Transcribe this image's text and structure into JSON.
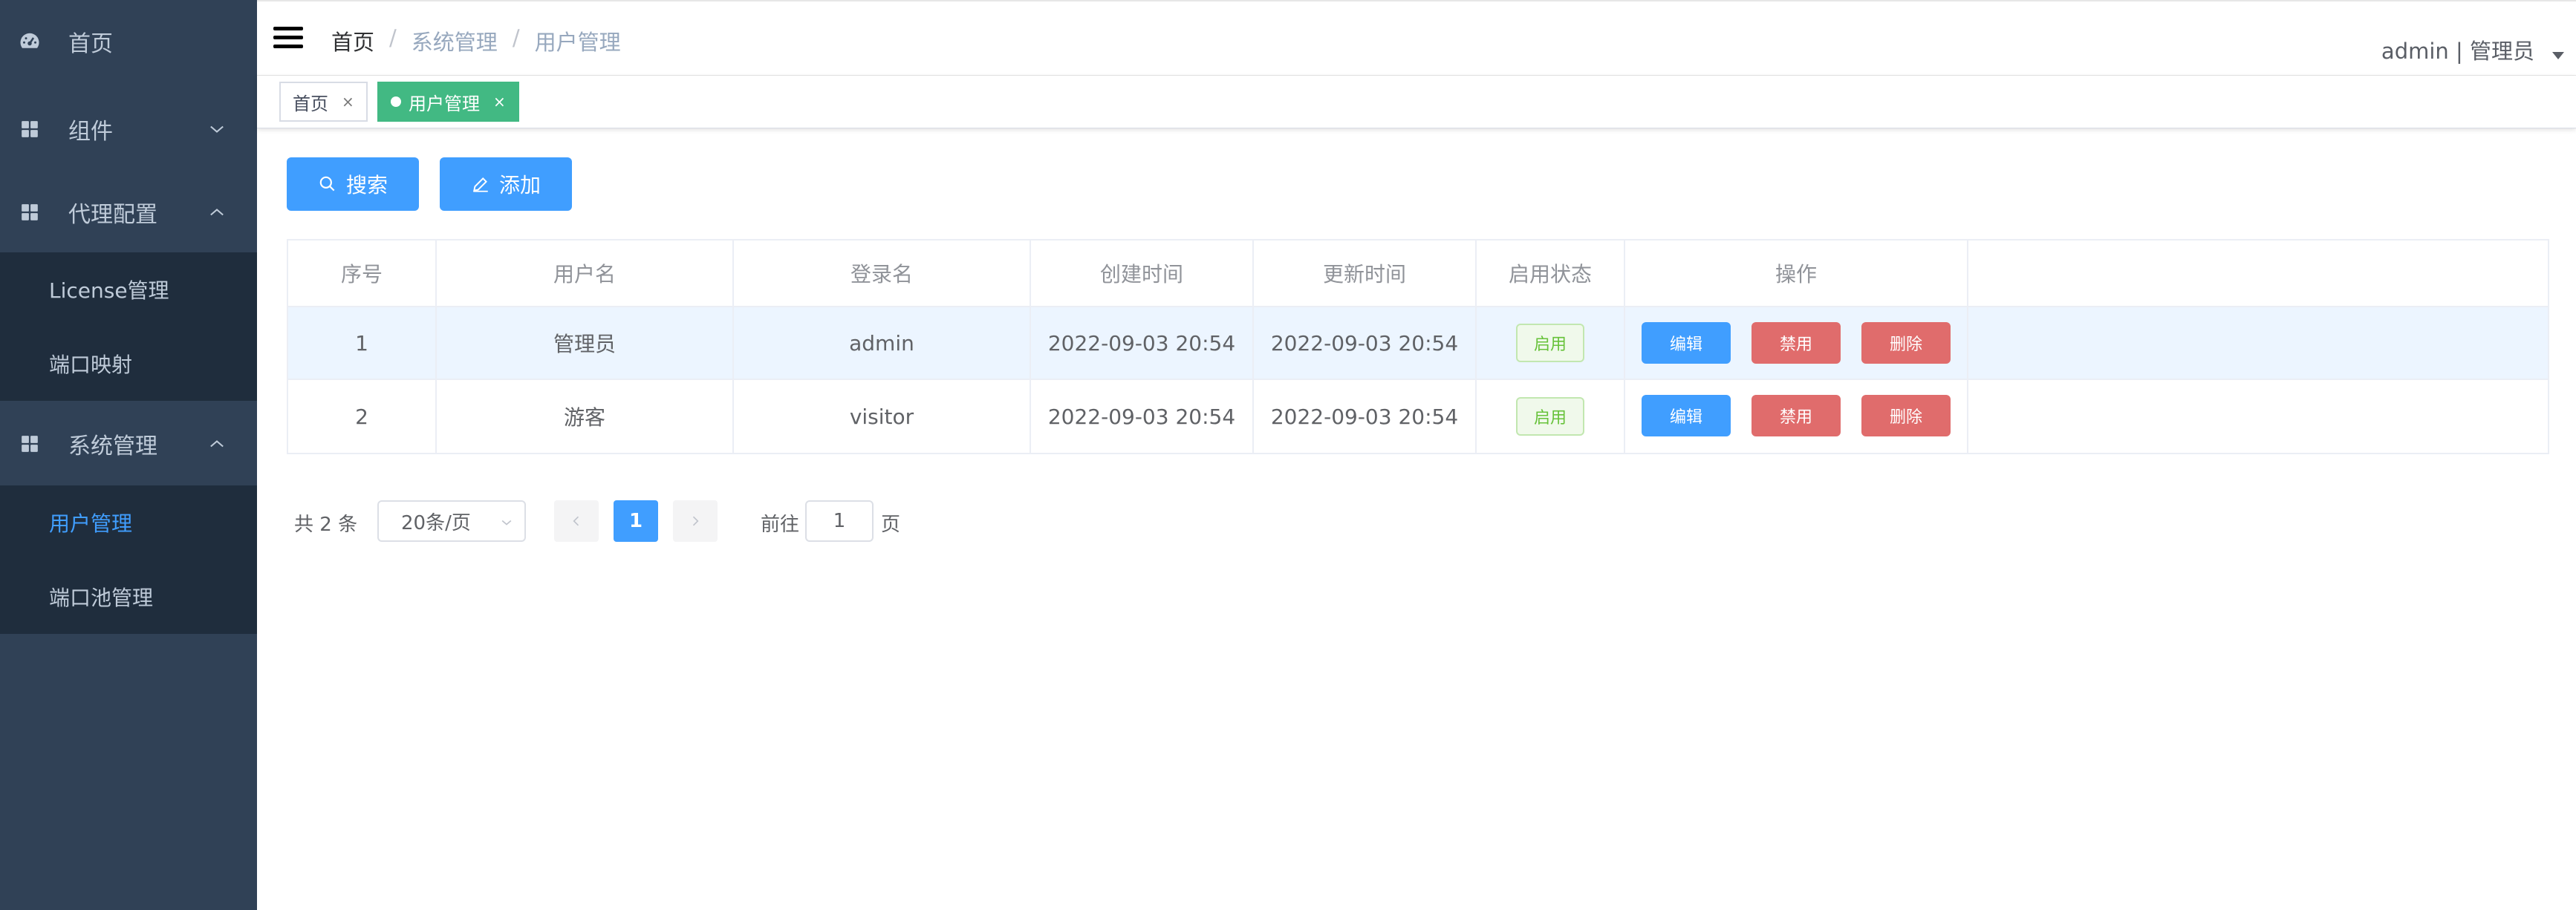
{
  "sidebar": {
    "items": [
      {
        "label": "首页",
        "icon": "dashboard-icon"
      },
      {
        "label": "组件",
        "icon": "grid-icon",
        "expanded": false
      },
      {
        "label": "代理配置",
        "icon": "grid-icon",
        "expanded": true,
        "children": [
          {
            "label": "License管理"
          },
          {
            "label": "端口映射"
          }
        ]
      },
      {
        "label": "系统管理",
        "icon": "grid-icon",
        "expanded": true,
        "children": [
          {
            "label": "用户管理",
            "active": true
          },
          {
            "label": "端口池管理"
          }
        ]
      }
    ]
  },
  "header": {
    "breadcrumb": [
      "首页",
      "系统管理",
      "用户管理"
    ],
    "breadcrumb_sep": "/",
    "user": "admin | 管理员"
  },
  "tags": [
    {
      "label": "首页",
      "close": "×",
      "active": false
    },
    {
      "label": "用户管理",
      "close": "×",
      "active": true
    }
  ],
  "toolbar": {
    "search_label": "搜索",
    "add_label": "添加"
  },
  "table": {
    "columns": [
      "序号",
      "用户名",
      "登录名",
      "创建时间",
      "更新时间",
      "启用状态",
      "操作"
    ],
    "rows": [
      {
        "index": "1",
        "username": "管理员",
        "login": "admin",
        "created": "2022-09-03 20:54",
        "updated": "2022-09-03 20:54",
        "status": "启用",
        "edit": "编辑",
        "disable": "禁用",
        "delete": "删除"
      },
      {
        "index": "2",
        "username": "游客",
        "login": "visitor",
        "created": "2022-09-03 20:54",
        "updated": "2022-09-03 20:54",
        "status": "启用",
        "edit": "编辑",
        "disable": "禁用",
        "delete": "删除"
      }
    ]
  },
  "pagination": {
    "total_text": "共 2 条",
    "page_size": "20条/页",
    "current_page": "1",
    "goto_label": "前往",
    "goto_value": "1",
    "page_suffix": "页"
  },
  "colors": {
    "sidebar_bg": "#304156",
    "submenu_bg": "#1f2d3d",
    "primary": "#409eff",
    "tag_active": "#42b983",
    "danger": "#e06c6c",
    "success": "#67c23a"
  }
}
